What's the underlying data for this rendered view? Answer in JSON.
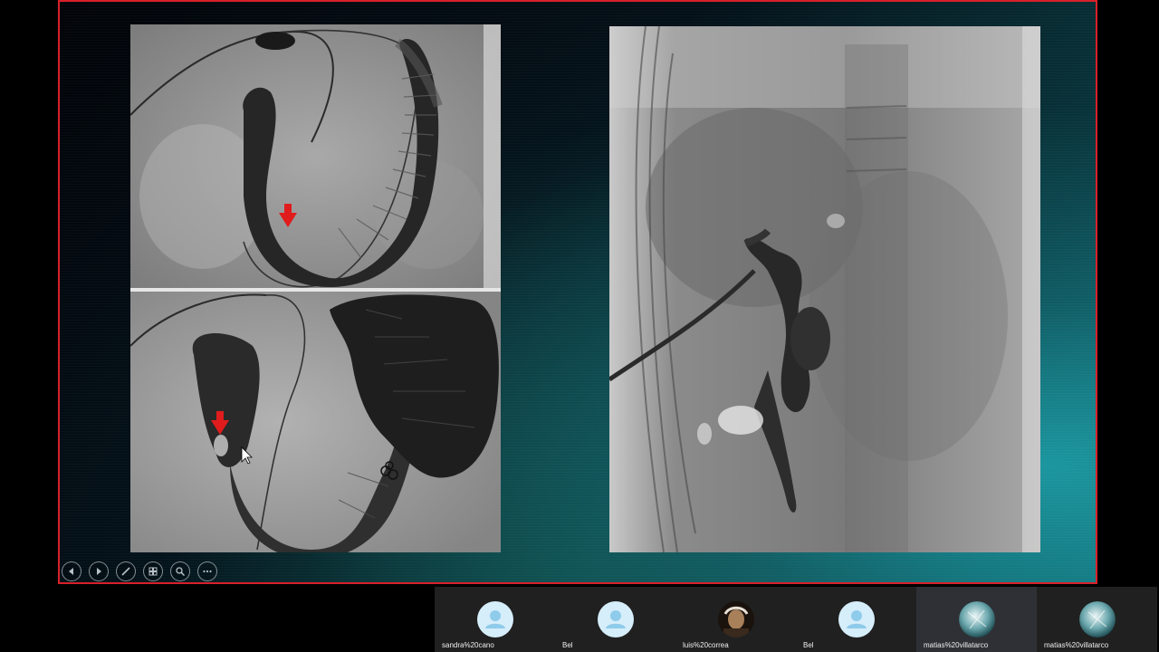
{
  "presentation": {
    "controls": [
      {
        "name": "previous-slide-button",
        "icon": "chevron-left-icon"
      },
      {
        "name": "next-slide-button",
        "icon": "chevron-right-icon"
      },
      {
        "name": "pen-button",
        "icon": "pen-icon"
      },
      {
        "name": "slides-grid-button",
        "icon": "grid-icon"
      },
      {
        "name": "zoom-button",
        "icon": "magnifier-icon"
      },
      {
        "name": "more-options-button",
        "icon": "more-icon"
      }
    ],
    "accent_color": "#d8202a",
    "marker_color": "#e01c1c"
  },
  "participants": [
    {
      "name": "sandra%20cano",
      "avatar": "default-user-icon"
    },
    {
      "name": "Bel",
      "avatar": "default-user-icon"
    },
    {
      "name": "luis%20correa",
      "avatar": "photo-avatar"
    },
    {
      "name": "Bel",
      "avatar": "default-user-icon"
    },
    {
      "name": "matias%20villatarco",
      "avatar": "globe-avatar",
      "active": true
    },
    {
      "name": "matias%20villatarco",
      "avatar": "globe-avatar"
    }
  ]
}
